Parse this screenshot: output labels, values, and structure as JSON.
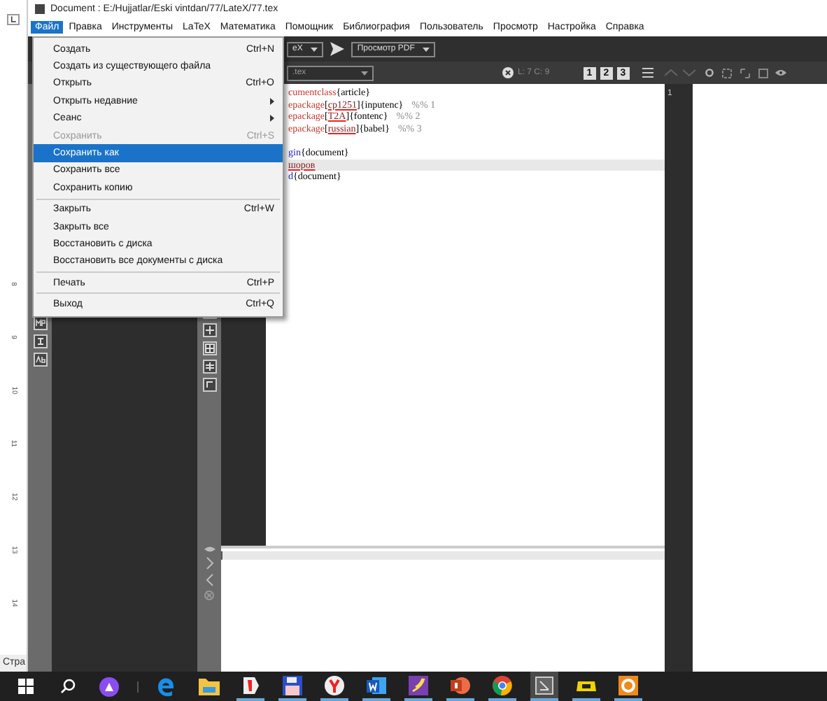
{
  "window": {
    "title": "Document : E:/Hujjatlar/Eski vintdan/77/LateX/77.tex"
  },
  "menubar": [
    {
      "label": "Файл",
      "selected": true
    },
    {
      "label": "Правка",
      "selected": false
    },
    {
      "label": "Инструменты",
      "selected": false
    },
    {
      "label": "LaTeX",
      "selected": false
    },
    {
      "label": "Математика",
      "selected": false
    },
    {
      "label": "Помощник",
      "selected": false
    },
    {
      "label": "Библиография",
      "selected": false
    },
    {
      "label": "Пользователь",
      "selected": false
    },
    {
      "label": "Просмотр",
      "selected": false
    },
    {
      "label": "Настройка",
      "selected": false
    },
    {
      "label": "Справка",
      "selected": false
    }
  ],
  "file_menu": [
    {
      "kind": "item",
      "label": "Создать",
      "shortcut": "Ctrl+N",
      "selected": false,
      "disabled": false,
      "submenu": false
    },
    {
      "kind": "item",
      "label": "Создать из существующего файла",
      "selected": false,
      "disabled": false,
      "submenu": false
    },
    {
      "kind": "item",
      "label": "Открыть",
      "shortcut": "Ctrl+O",
      "selected": false,
      "disabled": false,
      "submenu": false
    },
    {
      "kind": "item",
      "label": "Открыть недавние",
      "selected": false,
      "disabled": false,
      "submenu": true
    },
    {
      "kind": "item",
      "label": "Сеанс",
      "selected": false,
      "disabled": false,
      "submenu": true
    },
    {
      "kind": "item",
      "label": "Сохранить",
      "shortcut": "Ctrl+S",
      "selected": false,
      "disabled": true,
      "submenu": false
    },
    {
      "kind": "item",
      "label": "Сохранить как",
      "selected": true,
      "disabled": false,
      "submenu": false
    },
    {
      "kind": "item",
      "label": "Сохранить все",
      "selected": false,
      "disabled": false,
      "submenu": false
    },
    {
      "kind": "item",
      "label": "Сохранить копию",
      "selected": false,
      "disabled": false,
      "submenu": false
    },
    {
      "kind": "separator"
    },
    {
      "kind": "item",
      "label": "Закрыть",
      "shortcut": "Ctrl+W",
      "selected": false,
      "disabled": false,
      "submenu": false
    },
    {
      "kind": "item",
      "label": "Закрыть все",
      "selected": false,
      "disabled": false,
      "submenu": false
    },
    {
      "kind": "item",
      "label": "Восстановить с диска",
      "selected": false,
      "disabled": false,
      "submenu": false
    },
    {
      "kind": "item",
      "label": "Восстановить все документы с диска",
      "selected": false,
      "disabled": false,
      "submenu": false
    },
    {
      "kind": "separator"
    },
    {
      "kind": "item",
      "label": "Печать",
      "shortcut": "Ctrl+P",
      "selected": false,
      "disabled": false,
      "submenu": false
    },
    {
      "kind": "separator"
    },
    {
      "kind": "item",
      "label": "Выход",
      "shortcut": "Ctrl+Q",
      "selected": false,
      "disabled": false,
      "submenu": false
    }
  ],
  "toolbar": {
    "compile_combo": "eX",
    "viewer_combo": "Просмотр PDF",
    "file_combo": ".tex",
    "cursor_position": "L: 7 C: 9",
    "structure_buttons": [
      "1",
      "2",
      "3"
    ]
  },
  "editor": {
    "lines": [
      {
        "parts": [
          {
            "kind": "command",
            "text": "cumentclass"
          },
          {
            "kind": "plain",
            "text": "{article}"
          }
        ],
        "current": false
      },
      {
        "parts": [
          {
            "kind": "command",
            "text": "epackage"
          },
          {
            "kind": "plain",
            "text": "["
          },
          {
            "kind": "error",
            "text": "cp1251"
          },
          {
            "kind": "plain",
            "text": "]{inputenc}"
          },
          {
            "kind": "comment",
            "text": "%% 1"
          }
        ],
        "current": false
      },
      {
        "parts": [
          {
            "kind": "command",
            "text": "epackage"
          },
          {
            "kind": "plain",
            "text": "["
          },
          {
            "kind": "error",
            "text": "T2A"
          },
          {
            "kind": "plain",
            "text": "]{fontenc}"
          },
          {
            "kind": "comment",
            "text": "%% 2"
          }
        ],
        "current": false
      },
      {
        "parts": [
          {
            "kind": "command",
            "text": "epackage"
          },
          {
            "kind": "plain",
            "text": "["
          },
          {
            "kind": "error",
            "text": "russian"
          },
          {
            "kind": "plain",
            "text": "]{babel}"
          },
          {
            "kind": "comment",
            "text": "%% 3"
          }
        ],
        "current": false
      },
      {
        "current": false
      },
      {
        "parts": [
          {
            "kind": "env",
            "text": "gin"
          },
          {
            "kind": "plain",
            "text": "{document}"
          }
        ],
        "current": false
      },
      {
        "parts": [
          {
            "kind": "error",
            "text": "шоров"
          }
        ],
        "current": true
      },
      {
        "parts": [
          {
            "kind": "env",
            "text": "d"
          },
          {
            "kind": "plain",
            "text": "{document}"
          }
        ],
        "current": false
      }
    ]
  },
  "pdf_viewer": {
    "page_number": "1"
  },
  "ruler": {
    "labels": [
      "8",
      "9",
      "10",
      "11",
      "12",
      "13",
      "14"
    ]
  },
  "status_bar": {
    "text": "Стра"
  },
  "taskbar": [
    {
      "kind": "start",
      "active": false,
      "running": false
    },
    {
      "kind": "search",
      "active": false,
      "running": false
    },
    {
      "kind": "assistant",
      "active": false,
      "running": false
    },
    {
      "kind": "edge",
      "active": false,
      "running": false
    },
    {
      "kind": "folder",
      "active": false,
      "running": false
    },
    {
      "kind": "ybrowser",
      "active": false,
      "running": true
    },
    {
      "kind": "floppy",
      "active": false,
      "running": true
    },
    {
      "kind": "yandex",
      "active": false,
      "running": true
    },
    {
      "kind": "word",
      "active": false,
      "running": true
    },
    {
      "kind": "purple",
      "active": false,
      "running": true
    },
    {
      "kind": "powerpoint",
      "active": false,
      "running": true
    },
    {
      "kind": "chrome",
      "active": false,
      "running": true
    },
    {
      "kind": "texstudio",
      "active": true,
      "running": true
    },
    {
      "kind": "yellow",
      "active": false,
      "running": true
    },
    {
      "kind": "orange",
      "active": false,
      "running": true
    }
  ]
}
